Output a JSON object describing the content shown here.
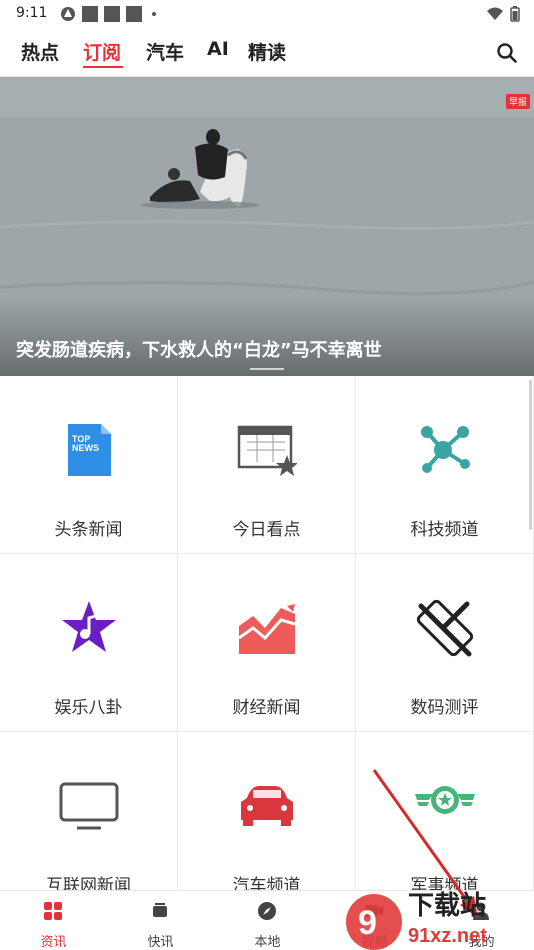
{
  "status_bar": {
    "time": "9:11"
  },
  "top_tabs": [
    {
      "label": "热点",
      "active": false
    },
    {
      "label": "订阅",
      "active": true
    },
    {
      "label": "汽车",
      "active": false
    },
    {
      "label": "AI",
      "active": false
    },
    {
      "label": "精读",
      "active": false
    }
  ],
  "hero": {
    "caption": "突发肠道疾病，下水救人的“白龙”马不幸离世",
    "badge": "早报"
  },
  "channels": [
    {
      "label": "头条新闻",
      "icon": "top-news-icon"
    },
    {
      "label": "今日看点",
      "icon": "calendar-star-icon"
    },
    {
      "label": "科技频道",
      "icon": "molecule-icon"
    },
    {
      "label": "娱乐八卦",
      "icon": "music-star-icon"
    },
    {
      "label": "财经新闻",
      "icon": "trend-chart-icon"
    },
    {
      "label": "数码测评",
      "icon": "phone-tools-icon"
    },
    {
      "label": "互联网新闻",
      "icon": "monitor-icon"
    },
    {
      "label": "汽车频道",
      "icon": "car-icon"
    },
    {
      "label": "军事频道",
      "icon": "military-badge-icon"
    }
  ],
  "top_news_icon_text": [
    "TOP",
    "NEWS"
  ],
  "bottom_nav": [
    {
      "label": "资讯",
      "active": true,
      "icon": "grid-icon"
    },
    {
      "label": "快讯",
      "active": false,
      "icon": "layers-icon"
    },
    {
      "label": "本地",
      "active": false,
      "icon": "compass-icon"
    },
    {
      "label": "视频",
      "active": false,
      "icon": "video-icon"
    },
    {
      "label": "我的",
      "active": false,
      "icon": "user-icon"
    }
  ],
  "watermark": {
    "text_top": "下载站",
    "text_bottom": "91xz.net"
  },
  "colors": {
    "accent": "#e8303a",
    "tech": "#3aa3a3",
    "ent": "#6a1fc4",
    "finance": "#ef5b5b",
    "car": "#d9373d",
    "military": "#49b47a"
  }
}
